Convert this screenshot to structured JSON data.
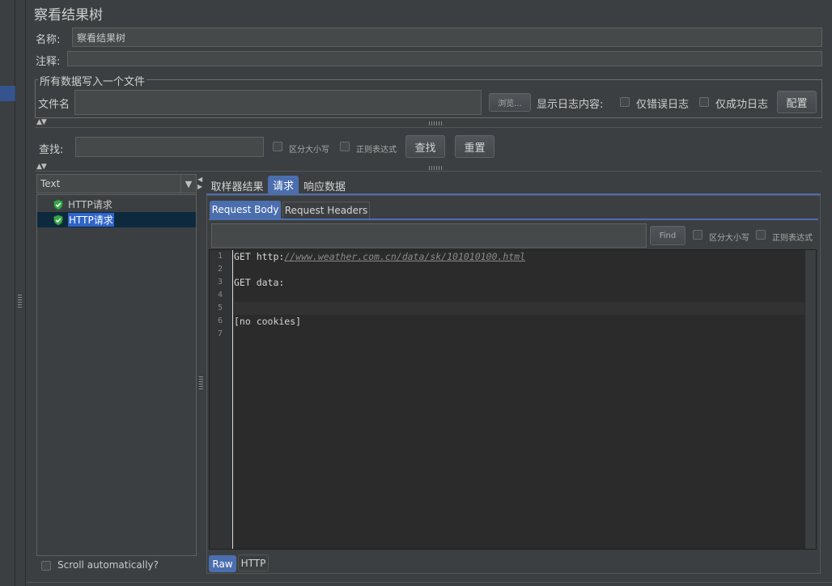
{
  "panel": {
    "title": "察看结果树",
    "name_label": "名称:",
    "name_value": "察看结果树",
    "comment_label": "注释:",
    "comment_value": ""
  },
  "file_group": {
    "legend": "所有数据写入一个文件",
    "filename_label": "文件名",
    "filename_value": "",
    "browse_button": "浏览...",
    "log_content_label": "显示日志内容:",
    "errors_only_label": "仅错误日志",
    "success_only_label": "仅成功日志",
    "configure_button": "配置"
  },
  "search": {
    "label": "查找:",
    "value": "",
    "case_sensitive_label": "区分大小写",
    "regex_label": "正则表达式",
    "find_button": "查找",
    "reset_button": "重置"
  },
  "renderer": {
    "selected": "Text",
    "arrow": "▼"
  },
  "results_tree": {
    "items": [
      {
        "label": "HTTP请求",
        "icon": "green-shield-check-icon",
        "selected": false
      },
      {
        "label": "HTTP请求",
        "icon": "green-shield-check-icon",
        "selected": true
      }
    ],
    "scroll_auto_label": "Scroll automatically?"
  },
  "result_tabs": [
    {
      "label": "取样器结果",
      "active": false
    },
    {
      "label": "请求",
      "active": true
    },
    {
      "label": "响应数据",
      "active": false
    }
  ],
  "request_subtabs": [
    {
      "label": "Request Body",
      "active": true
    },
    {
      "label": "Request Headers",
      "active": false
    }
  ],
  "editor_search": {
    "value": "",
    "find_button": "Find",
    "case_sensitive_label": "区分大小写",
    "regex_label": "正则表达式"
  },
  "editor": {
    "line_numbers": [
      "1",
      "2",
      "3",
      "4",
      "5",
      "6",
      "7"
    ],
    "line1_prefix": "GET http:",
    "line1_url": "//www.weather.com.cn/data/sk/101010100.html",
    "line3": "GET data:",
    "line6": "[no cookies]"
  },
  "bottom_tabs": [
    {
      "label": "Raw",
      "active": true
    },
    {
      "label": "HTTP",
      "active": false
    }
  ],
  "colors": {
    "background": "#3c3f41",
    "accent": "#4b6eaf",
    "selection": "#2f65ca",
    "editor_bg": "#2b2b2b",
    "shield_green": "#3aa84a"
  }
}
